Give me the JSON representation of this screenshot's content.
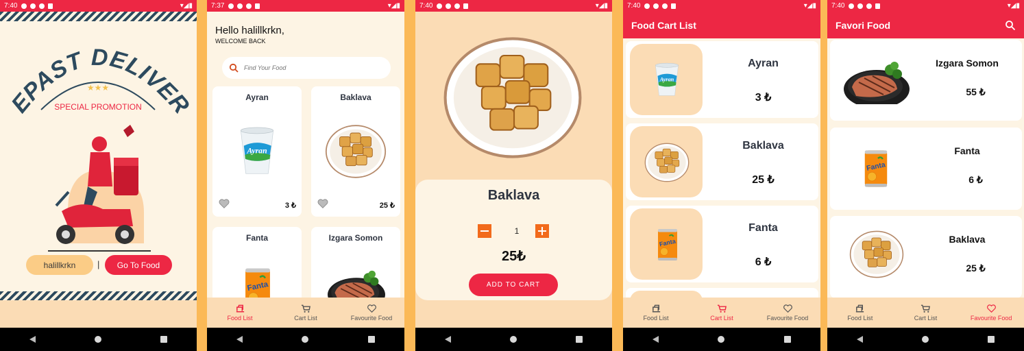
{
  "status": {
    "time_1": "7:40",
    "time_2": "7:37",
    "time_3": "7:40",
    "time_4": "7:40",
    "time_5": "7:40"
  },
  "colors": {
    "primary": "#ed2744",
    "cream": "#fdf4e4",
    "peach": "#fbdcb5",
    "orange": "#f26a1b",
    "navy": "#2d4a5e"
  },
  "splash": {
    "brand_text": "REPAST DELIVERY",
    "promo": "SPECIAL PROMOTION",
    "username": "halillkrkn",
    "separator": "|",
    "go_button": "Go To Food"
  },
  "food_list": {
    "hello": "Hello halillkrkn,",
    "welcome": "WELCOME BACK",
    "search_placeholder": "Find Your Food",
    "items": [
      {
        "name": "Ayran",
        "price": "3 ₺",
        "icon": "ayran-cup"
      },
      {
        "name": "Baklava",
        "price": "25 ₺",
        "icon": "baklava-plate"
      },
      {
        "name": "Fanta",
        "price": "",
        "icon": "fanta-can"
      },
      {
        "name": "Izgara Somon",
        "price": "",
        "icon": "salmon-plate"
      }
    ]
  },
  "detail": {
    "name": "Baklava",
    "quantity": "1",
    "price": "25₺",
    "add_button": "ADD TO CART"
  },
  "cart": {
    "title": "Food Cart List",
    "items": [
      {
        "name": "Ayran",
        "price": "3 ₺"
      },
      {
        "name": "Baklava",
        "price": "25 ₺"
      },
      {
        "name": "Fanta",
        "price": "6 ₺"
      }
    ]
  },
  "favorites": {
    "title": "Favori Food",
    "items": [
      {
        "name": "Izgara Somon",
        "price": "55 ₺"
      },
      {
        "name": "Fanta",
        "price": "6 ₺"
      },
      {
        "name": "Baklava",
        "price": "25 ₺"
      }
    ]
  },
  "bottom_nav": {
    "food_list": "Food List",
    "cart_list": "Cart List",
    "favourite": "Favourite Food"
  }
}
